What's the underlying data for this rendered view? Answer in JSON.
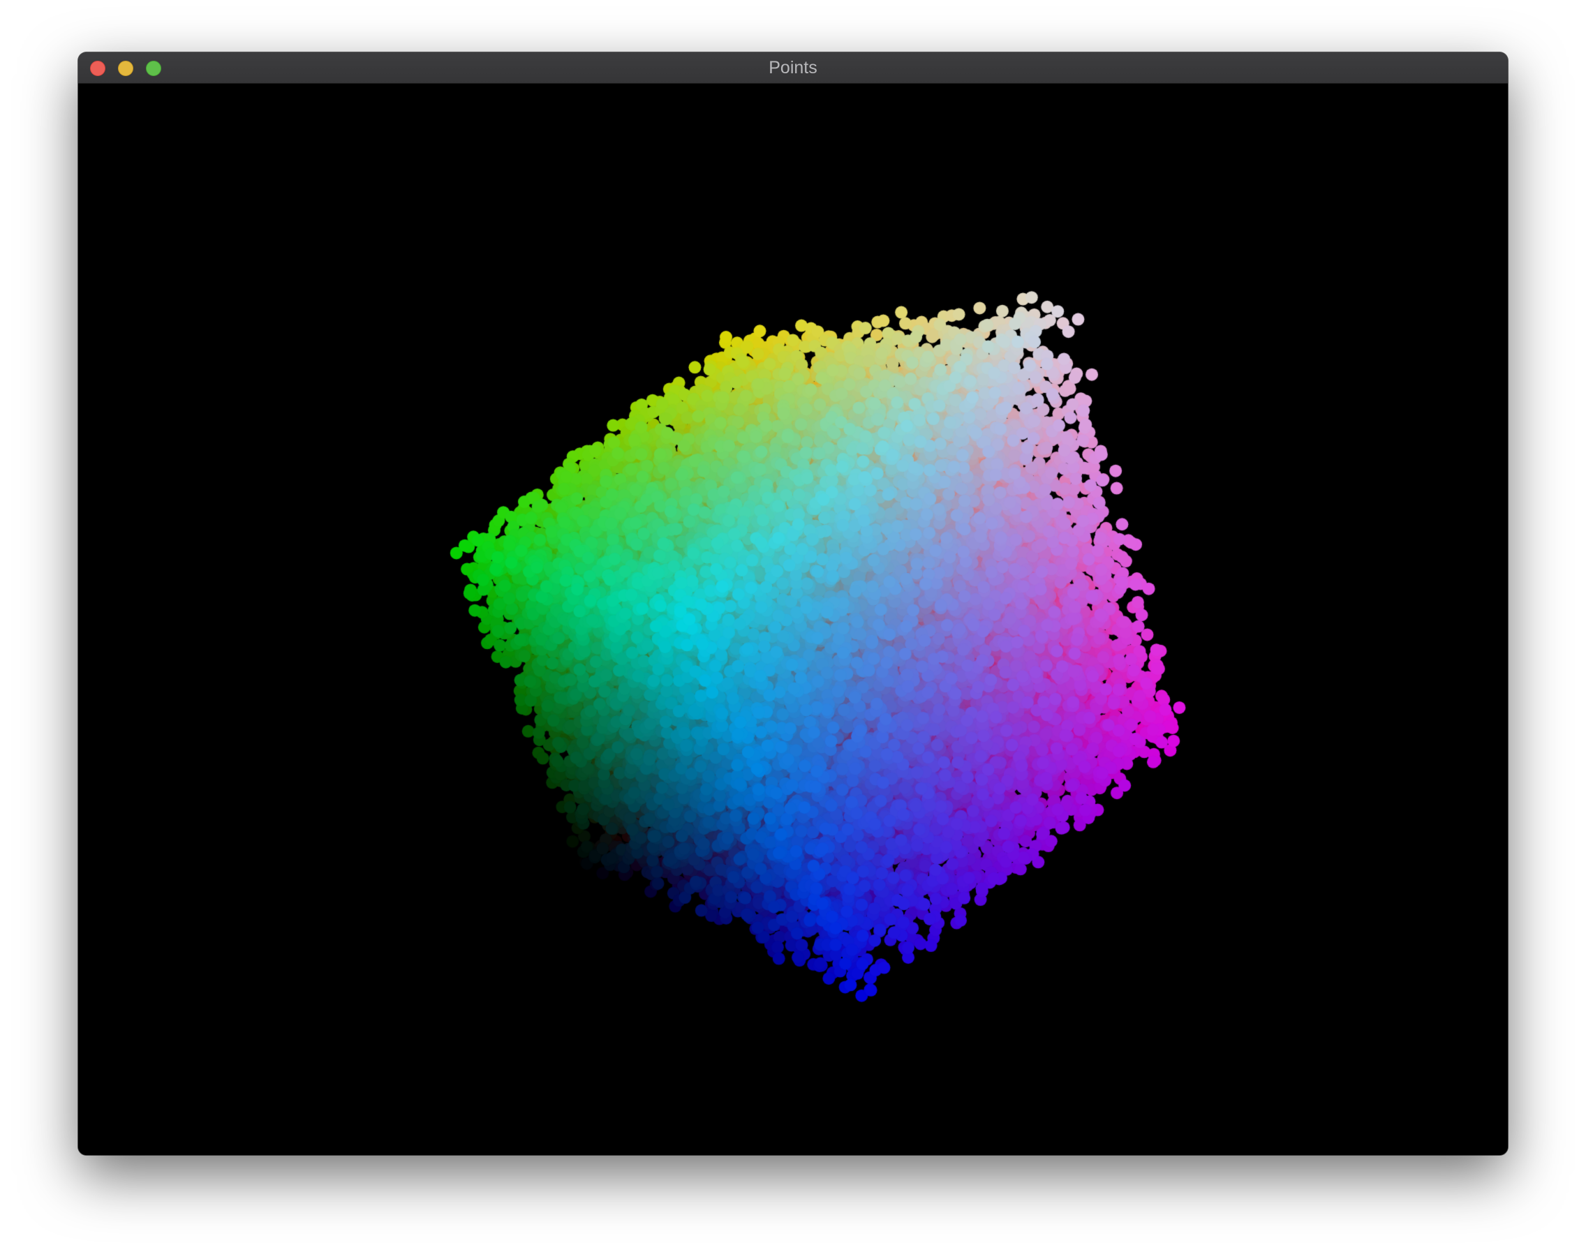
{
  "window": {
    "title": "Points",
    "controls": {
      "close": {
        "icon": "close-icon",
        "color": "#ed5f57"
      },
      "minimize": {
        "icon": "minimize-icon",
        "color": "#e4b83d"
      },
      "zoom": {
        "icon": "zoom-icon",
        "color": "#5fc04a"
      }
    }
  },
  "viewport": {
    "background": "#000000",
    "content": "point-cloud",
    "color_mapping": "rgb-cube",
    "corner_colors": {
      "black": "#000000",
      "red": "#e93434",
      "green": "#4ec43a",
      "blue": "#1a2ee0",
      "yellow": "#d9d43a",
      "cyan": "#4fd6cf",
      "magenta": "#d23ae0",
      "white": "#e6e6e6"
    }
  }
}
